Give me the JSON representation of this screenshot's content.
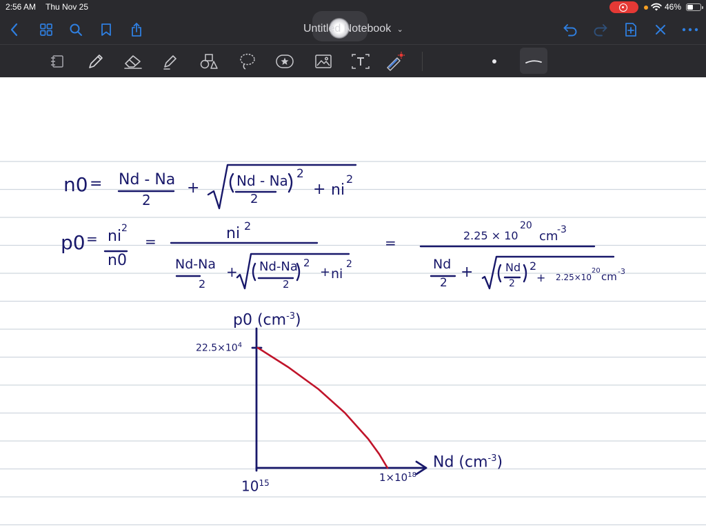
{
  "status_bar": {
    "time": "2:56 AM",
    "date": "Thu Nov 25",
    "battery": "46%",
    "colors": {
      "recording": "#e53935",
      "orange_dot": "#f7a024"
    }
  },
  "nav_bar": {
    "title": "Untitled Notebook",
    "left_icons": [
      "back-icon",
      "grid-icon",
      "search-icon",
      "bookmark-icon",
      "share-icon"
    ],
    "right_icons": [
      "undo-icon",
      "redo-icon",
      "add-page-icon",
      "close-icon",
      "more-icon"
    ],
    "accent_color": "#2f7fe0"
  },
  "toolbar": {
    "tools": [
      "lasso-select-icon",
      "pen-icon",
      "eraser-icon",
      "highlighter-icon",
      "shapes-icon",
      "lasso-icon",
      "sticker-icon",
      "image-icon",
      "text-icon",
      "laser-pointer-icon"
    ],
    "pen_color": "dark-navy"
  },
  "notes": {
    "eq1": {
      "lhs": "n0",
      "equals": "=",
      "frac_num": "Nd - Na",
      "frac_den": "2",
      "plus": "+",
      "sqrt_num": "Nd - Na",
      "sqrt_den": "2",
      "sq": "2",
      "plus2": "+",
      "ni": "ni",
      "ni_sq": "2"
    },
    "eq2": {
      "lhs": "p0",
      "eq": "=",
      "frac1_num": "ni",
      "frac1_num_sup": "2",
      "frac1_den": "n0",
      "eq2": "=",
      "mid_num": "ni",
      "mid_num_sup": "2",
      "mid_den_frac_num": "Nd-Na",
      "mid_den_frac_den": "2",
      "mid_plus": "+",
      "mid_sqrt_num": "Nd-Na",
      "mid_sqrt_den": "2",
      "mid_sq": "2",
      "mid_plus2": "+",
      "mid_ni": "ni",
      "mid_ni_sq": "2",
      "eq3": "=",
      "right_num": "2.25 × 10",
      "right_num_exp": "20",
      "right_num_unit": "cm",
      "right_num_unit_exp": "-3",
      "right_den_frac_num": "Nd",
      "right_den_frac_den": "2",
      "right_plus": "+",
      "right_sqrt_num": "Nd",
      "right_sqrt_den": "2",
      "right_sq": "2",
      "right_plus2": "+",
      "right_const": "2.25×10",
      "right_const_exp": "20",
      "right_const_unit": "cm",
      "right_const_unit_exp": "-3"
    },
    "graph": {
      "y_label": "p0 (cm",
      "y_label_exp": "-3",
      "y_label_close": ")",
      "y_tick": "22.5×10",
      "y_tick_exp": "4",
      "x_label": "Nd (cm",
      "x_label_exp": "-3",
      "x_label_close": ")",
      "x_tick_left": "10",
      "x_tick_left_exp": "15",
      "x_tick_right": "1×10",
      "x_tick_right_exp": "18",
      "curve_color": "#c0142a",
      "ink_color": "#18186a"
    }
  },
  "paper": {
    "rule_color": "#cfd6de"
  }
}
